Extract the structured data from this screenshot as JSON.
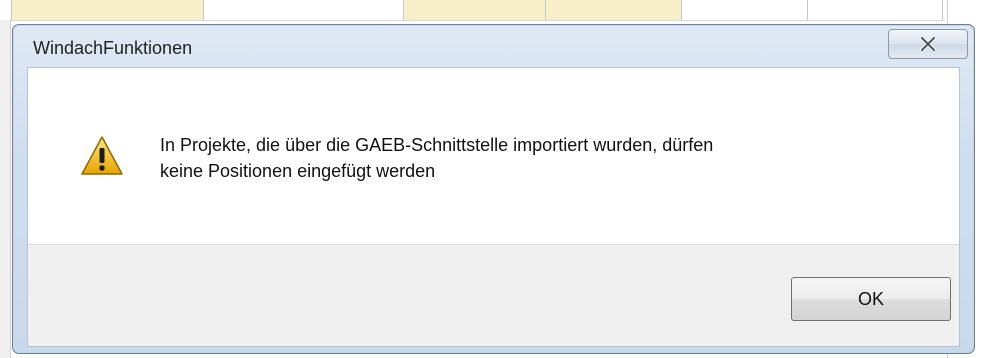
{
  "dialog": {
    "title": "WindachFunktionen",
    "message_line1": "In Projekte, die über die GAEB-Schnittstelle importiert wurden, dürfen",
    "message_line2": "keine Positionen eingefügt werden",
    "icon": "warning-icon",
    "ok_label": "OK",
    "close_icon": "close-icon"
  },
  "colors": {
    "frame": "#cfdeef",
    "footer": "#f0f0f0",
    "warning_fill": "#f5c518",
    "bg_highlight": "#f6efc9"
  }
}
